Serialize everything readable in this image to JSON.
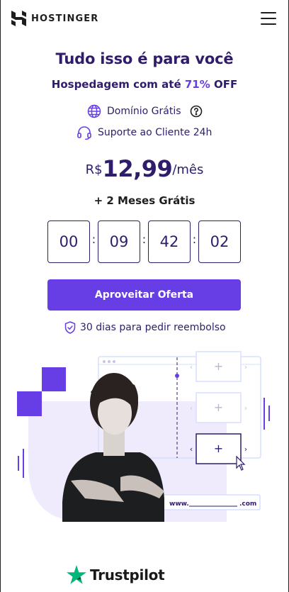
{
  "header": {
    "brand": "HOSTINGER",
    "logo_icon": "hostinger-logo-icon",
    "menu_icon": "hamburger-menu-icon"
  },
  "hero": {
    "title": "Tudo isso é para você",
    "subtitle_prefix": "Hospedagem com até ",
    "subtitle_discount": "71%",
    "subtitle_suffix": " OFF",
    "features": [
      {
        "label": "Domínio Grátis",
        "icon": "globe-icon",
        "extra_icon": "help-circle-icon"
      },
      {
        "label": "Suporte ao Cliente 24h",
        "icon": "headset-icon"
      }
    ],
    "price": {
      "currency": "R$",
      "amount": "12,99",
      "period": "/mês"
    },
    "bonus": "+ 2 Meses Grátis",
    "countdown": {
      "days": "00",
      "hours": "09",
      "minutes": "42",
      "seconds": "02",
      "separator": ":"
    },
    "cta_label": "Aproveitar Oferta",
    "refund_text": "30 dias para pedir reembolso"
  },
  "illustration": {
    "url_prefix": "www.",
    "url_suffix": ".com"
  },
  "footer": {
    "trustpilot_label": "Trustpilot"
  },
  "colors": {
    "primary": "#673de6",
    "dark": "#2f1c6a",
    "light_purple": "#efebfd"
  }
}
